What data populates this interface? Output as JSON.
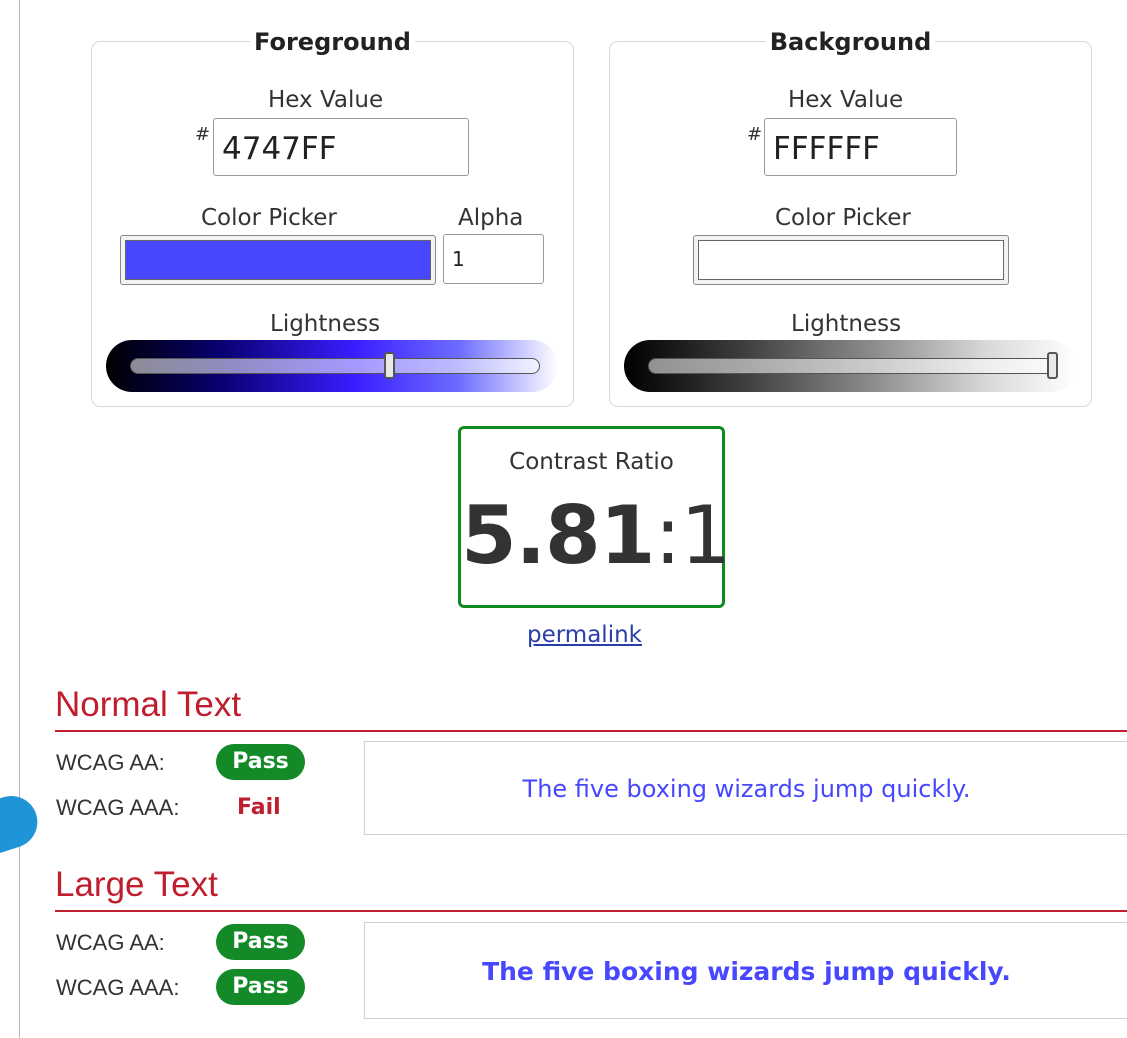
{
  "foreground": {
    "legend": "Foreground",
    "hex_label": "Hex Value",
    "hash": "#",
    "hex_value": "4747FF",
    "picker_label": "Color Picker",
    "picker_color": "#4747ff",
    "alpha_label": "Alpha",
    "alpha_value": "1",
    "lightness_label": "Lightness",
    "lightness_fraction": 0.64
  },
  "background": {
    "legend": "Background",
    "hex_label": "Hex Value",
    "hash": "#",
    "hex_value": "FFFFFF",
    "picker_label": "Color Picker",
    "picker_color": "#ffffff",
    "lightness_label": "Lightness",
    "lightness_fraction": 1.0
  },
  "contrast": {
    "title": "Contrast Ratio",
    "ratio_main": "5.81",
    "ratio_suffix": ":1",
    "permalink": "permalink"
  },
  "normal_text": {
    "title": "Normal Text",
    "aa_label": "WCAG AA:",
    "aa_result": "Pass",
    "aaa_label": "WCAG AAA:",
    "aaa_result": "Fail",
    "sample": "The five boxing wizards jump quickly."
  },
  "large_text": {
    "title": "Large Text",
    "aa_label": "WCAG AA:",
    "aa_result": "Pass",
    "aaa_label": "WCAG AAA:",
    "aaa_result": "Pass",
    "sample": "The five boxing wizards jump quickly."
  },
  "colors": {
    "pass_green": "#138a27",
    "fail_red": "#be1e2d",
    "accent_border": "#0f8a1e",
    "link": "#2a3ea8"
  }
}
